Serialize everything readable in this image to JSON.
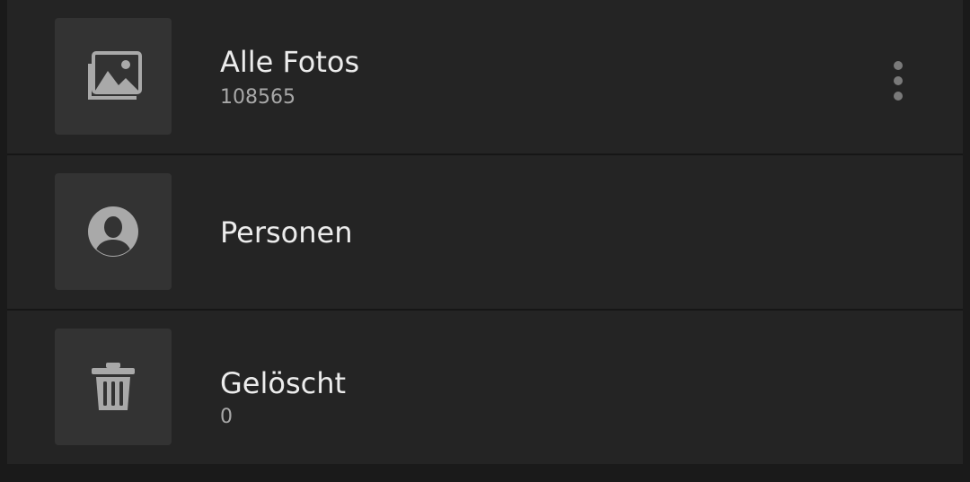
{
  "albums": [
    {
      "title": "Alle Fotos",
      "count": "108565",
      "icon": "photos-icon",
      "has_menu": true
    },
    {
      "title": "Personen",
      "icon": "person-icon"
    },
    {
      "title": "Gelöscht",
      "count": "0",
      "icon": "trash-icon"
    }
  ],
  "colors": {
    "background": "#1a1a1a",
    "row": "#242424",
    "thumb": "#333333",
    "icon": "#a9a9a9",
    "title": "#ececec",
    "count": "#a8a8a8"
  }
}
